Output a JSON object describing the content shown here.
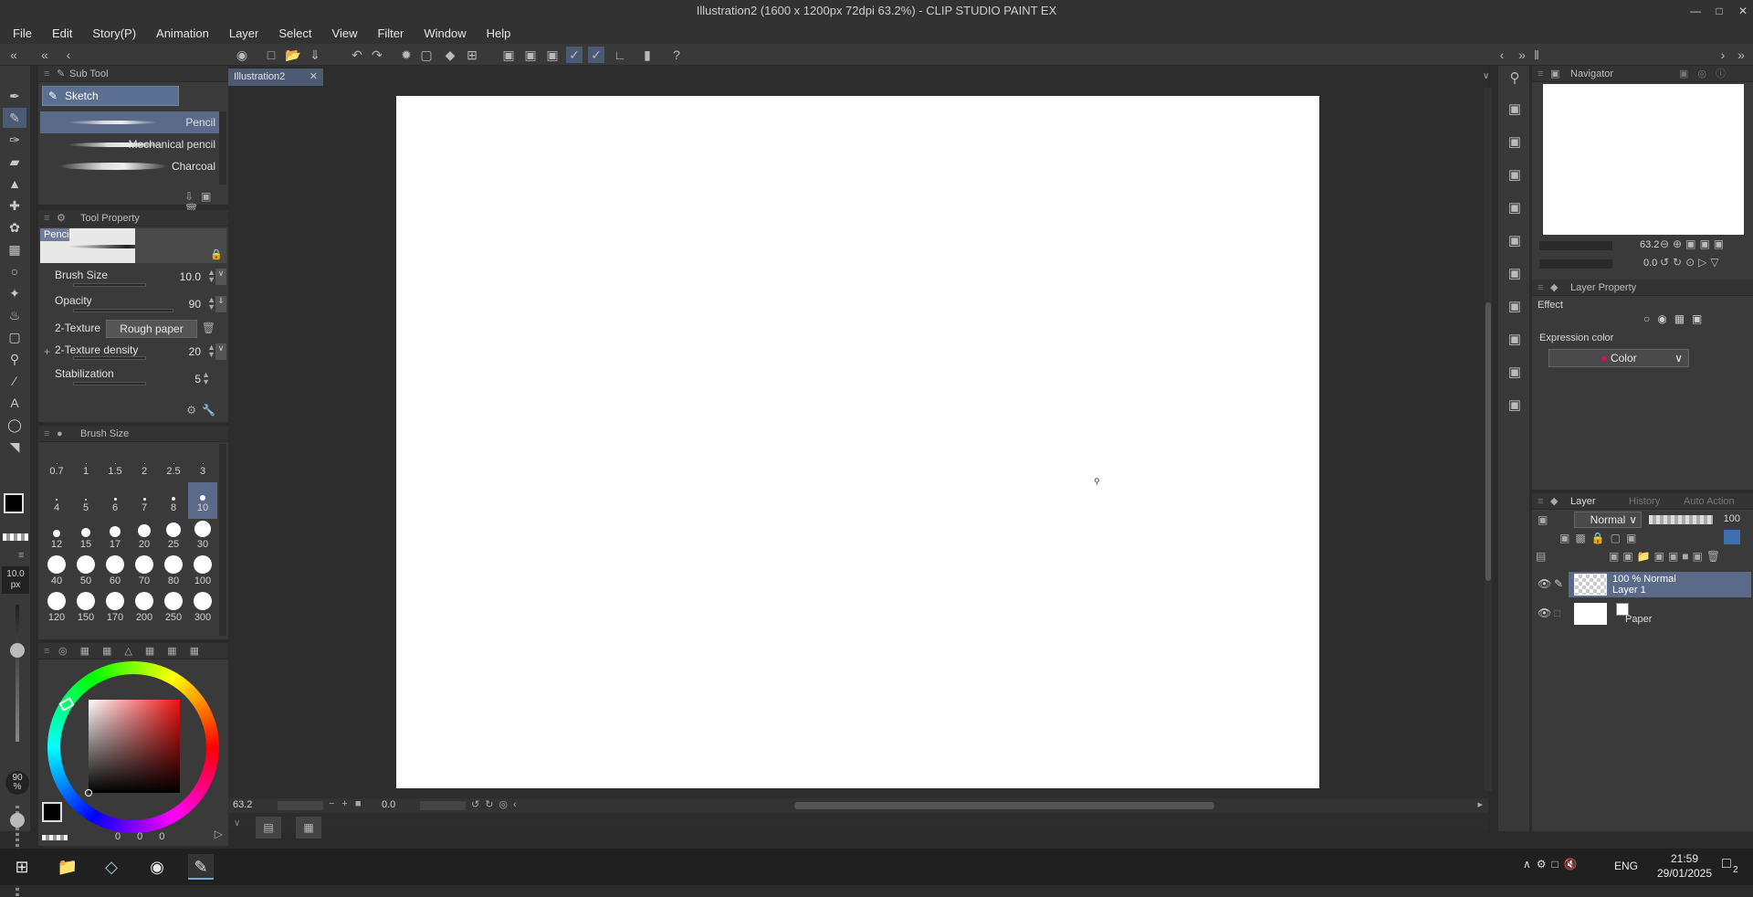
{
  "window": {
    "title": "Illustration2 (1600 x 1200px 72dpi 63.2%)  - CLIP STUDIO PAINT EX"
  },
  "menu": [
    "File",
    "Edit",
    "Story(P)",
    "Animation",
    "Layer",
    "Select",
    "View",
    "Filter",
    "Window",
    "Help"
  ],
  "document_tab": {
    "label": "Illustration2"
  },
  "sub_tool": {
    "title": "Sub Tool",
    "group": "Sketch",
    "brushes": [
      "Pencil",
      "Mechanical pencil",
      "Charcoal"
    ]
  },
  "tool_property": {
    "title": "Tool Property",
    "preview_label": "Pencil",
    "brush_size": {
      "label": "Brush Size",
      "value": "10.0"
    },
    "opacity": {
      "label": "Opacity",
      "value": "90"
    },
    "texture": {
      "label": "2-Texture",
      "value": "Rough paper"
    },
    "texture_density": {
      "label": "2-Texture density",
      "value": "20"
    },
    "stabilization": {
      "label": "Stabilization",
      "value": "5"
    }
  },
  "brush_size_panel": {
    "title": "Brush Size",
    "sizes": [
      "0.7",
      "1",
      "1.5",
      "2",
      "2.5",
      "3",
      "4",
      "5",
      "6",
      "7",
      "8",
      "10",
      "12",
      "15",
      "17",
      "20",
      "25",
      "30",
      "40",
      "50",
      "60",
      "70",
      "80",
      "100",
      "120",
      "150",
      "170",
      "200",
      "250",
      "300"
    ],
    "selected": "10"
  },
  "left_toolbar": {
    "size_label": "10.0",
    "size_unit": "px",
    "opacity_label": "90",
    "opacity_unit": "%"
  },
  "color_panel": {
    "values": [
      "0",
      "0",
      "0"
    ]
  },
  "status": {
    "zoom": "63.2",
    "angle": "0.0"
  },
  "navigator": {
    "title": "Navigator",
    "zoom": "63.2",
    "rotation": "0.0"
  },
  "layer_property": {
    "title": "Layer Property",
    "effect_label": "Effect",
    "expression_label": "Expression color",
    "expression_value": "Color"
  },
  "layer_panel": {
    "tabs": [
      "Layer",
      "History",
      "Auto Action"
    ],
    "blend_mode": "Normal",
    "opacity": "100",
    "layers": [
      {
        "line1": "100 % Normal",
        "line2": "Layer 1"
      },
      {
        "line1": "",
        "line2": "Paper"
      }
    ]
  },
  "taskbar": {
    "time": "21:59",
    "date": "29/01/2025",
    "lang": "ENG",
    "notif_count": "2"
  },
  "colors": {
    "accent": "#5a6a88",
    "panel": "#3a3a3a",
    "canvas": "#ffffff"
  }
}
